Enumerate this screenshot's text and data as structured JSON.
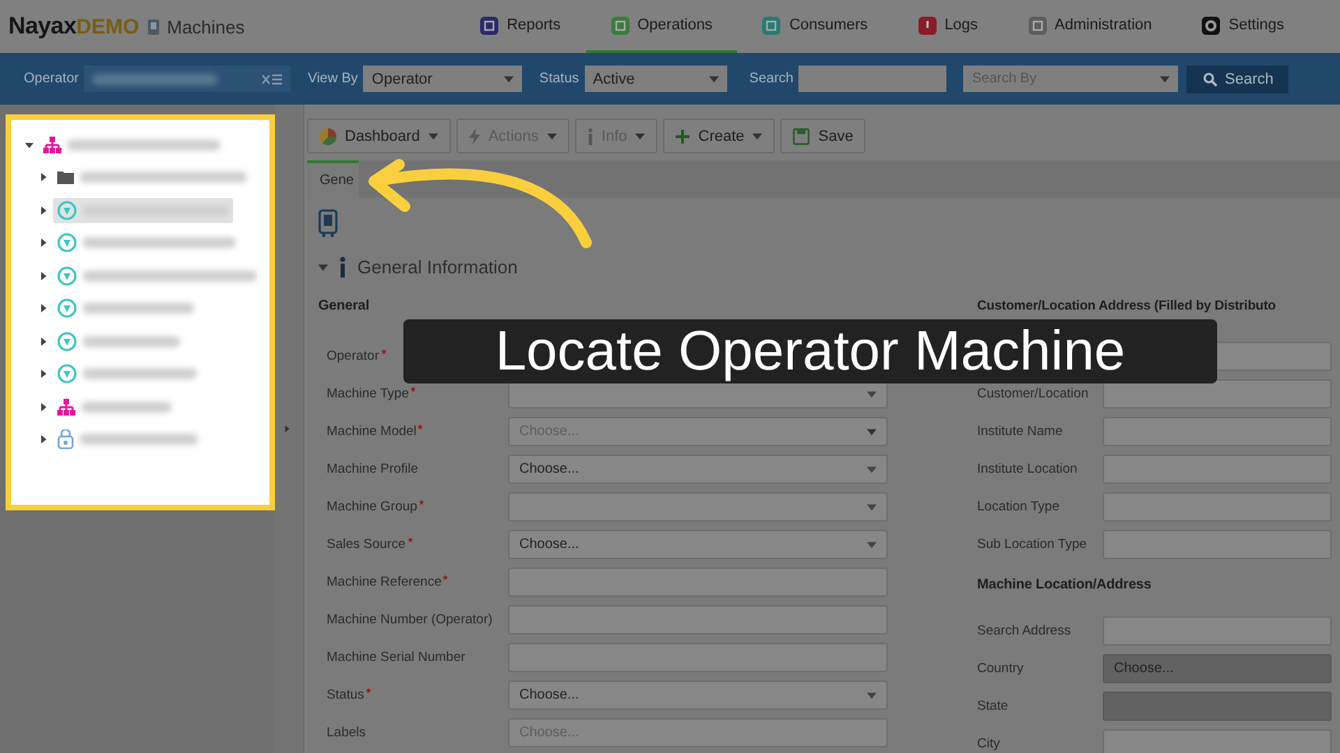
{
  "header": {
    "brand": "Nayax",
    "brand_suffix": "DEMO",
    "page_title": "Machines",
    "nav": [
      {
        "label": "Reports",
        "kind": "reports",
        "selected": false
      },
      {
        "label": "Operations",
        "kind": "operations",
        "selected": true
      },
      {
        "label": "Consumers",
        "kind": "consumers",
        "selected": false
      },
      {
        "label": "Logs",
        "kind": "logs",
        "selected": false
      },
      {
        "label": "Administration",
        "kind": "administration",
        "selected": false
      },
      {
        "label": "Settings",
        "kind": "settings",
        "selected": false
      }
    ]
  },
  "filter_bar": {
    "operator_label": "Operator",
    "view_by_label": "View By",
    "view_by_value": "Operator",
    "status_label": "Status",
    "status_value": "Active",
    "search_label": "Search",
    "search_by_placeholder": "Search By",
    "search_button": "Search"
  },
  "tree": {
    "kind": "org",
    "expanded": true,
    "children": [
      {
        "kind": "folder",
        "selected": false,
        "expanded": false
      },
      {
        "kind": "machine",
        "selected": true,
        "expanded": false
      },
      {
        "kind": "machine",
        "selected": false,
        "expanded": false
      },
      {
        "kind": "machine",
        "selected": false,
        "expanded": false
      },
      {
        "kind": "machine",
        "selected": false,
        "expanded": false
      },
      {
        "kind": "machine",
        "selected": false,
        "expanded": false
      },
      {
        "kind": "machine",
        "selected": false,
        "expanded": false
      },
      {
        "kind": "org",
        "selected": false,
        "expanded": false
      },
      {
        "kind": "bag",
        "selected": false,
        "expanded": false
      }
    ]
  },
  "toolbar": [
    {
      "label": "Dashboard",
      "kind": "pie",
      "menu": true,
      "disabled": false
    },
    {
      "label": "Actions",
      "kind": "bolt",
      "menu": true,
      "disabled": true
    },
    {
      "label": "Info",
      "kind": "info",
      "menu": true,
      "disabled": true
    },
    {
      "label": "Create",
      "kind": "plus",
      "menu": true,
      "disabled": false
    },
    {
      "label": "Save",
      "kind": "save",
      "menu": false,
      "disabled": false
    }
  ],
  "tabs": [
    {
      "label": "Gene",
      "selected": true
    }
  ],
  "section": {
    "title": "General Information",
    "expanded": true
  },
  "general": {
    "heading": "General",
    "fields": [
      {
        "label": "Operator",
        "required": true
      },
      {
        "label": "Machine Type",
        "required": true,
        "kind": "select"
      },
      {
        "label": "Machine Model",
        "required": true,
        "kind": "select",
        "placeholder": "Choose..."
      },
      {
        "label": "Machine Profile",
        "required": false,
        "kind": "select",
        "value": "Choose..."
      },
      {
        "label": "Machine Group",
        "required": true,
        "kind": "select"
      },
      {
        "label": "Sales Source",
        "required": true,
        "kind": "select",
        "value": "Choose..."
      },
      {
        "label": "Machine Reference",
        "required": true,
        "kind": "input"
      },
      {
        "label": "Machine Number (Operator)",
        "required": false,
        "kind": "input"
      },
      {
        "label": "Machine Serial Number",
        "required": false,
        "kind": "input"
      },
      {
        "label": "Status",
        "required": true,
        "kind": "select",
        "value": "Choose..."
      },
      {
        "label": "Labels",
        "required": false,
        "kind": "input",
        "placeholder": "Choose..."
      }
    ]
  },
  "customer_address": {
    "heading": "Customer/Location Address (Filled by Distributo",
    "fields": [
      {
        "kind": "input",
        "disabled": false
      },
      {
        "label": "Customer/Location",
        "kind": "input",
        "disabled": false
      },
      {
        "label": "Institute Name",
        "kind": "input",
        "disabled": false
      },
      {
        "label": "Institute Location",
        "kind": "input",
        "disabled": false
      },
      {
        "label": "Location Type",
        "kind": "input",
        "disabled": false
      },
      {
        "label": "Sub Location Type",
        "kind": "input",
        "disabled": false
      }
    ]
  },
  "machine_location": {
    "heading": "Machine Location/Address",
    "fields": [
      {
        "label": "Search Address",
        "kind": "input",
        "disabled": false
      },
      {
        "label": "Country",
        "kind": "input",
        "value": "Choose...",
        "disabled": true
      },
      {
        "label": "State",
        "kind": "input",
        "disabled": true
      },
      {
        "label": "City",
        "kind": "input",
        "disabled": false
      }
    ]
  },
  "callout": {
    "text": "Locate Operator Machine"
  }
}
